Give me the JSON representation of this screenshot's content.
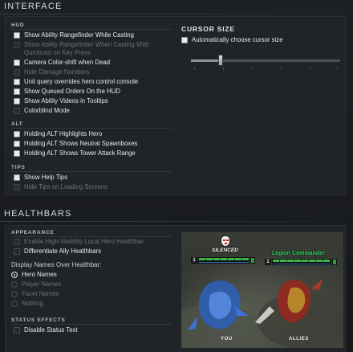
{
  "interface": {
    "title": "INTERFACE",
    "hud": {
      "label": "HUD",
      "options": [
        {
          "label": "Show Ability Rangefinder While Casting",
          "checked": true,
          "disabled": false
        },
        {
          "label": "Show Ability Rangefinder When Casting With",
          "label2": "Quickcast on Key Press",
          "checked": false,
          "disabled": true
        },
        {
          "label": "Camera Color-shift when Dead",
          "checked": true,
          "disabled": false
        },
        {
          "label": "Hide Damage Numbers",
          "checked": false,
          "disabled": true
        },
        {
          "label": "Unit query overrides hero control console",
          "checked": true,
          "disabled": false
        },
        {
          "label": "Show Queued Orders On the HUD",
          "checked": true,
          "disabled": false
        },
        {
          "label": "Show Ability Videos in Tooltips",
          "checked": true,
          "disabled": false
        },
        {
          "label": "Colorblind Mode",
          "checked": false,
          "disabled": false
        }
      ]
    },
    "alt": {
      "label": "ALT",
      "options": [
        {
          "label": "Holding ALT Highlights Hero",
          "checked": true,
          "disabled": false
        },
        {
          "label": "Holding ALT Shows Neutral Spawnboxes",
          "checked": true,
          "disabled": false
        },
        {
          "label": "Holding ALT Shows Tower Attack Range",
          "checked": true,
          "disabled": false
        }
      ]
    },
    "tips": {
      "label": "TIPS",
      "options": [
        {
          "label": "Show Help Tips",
          "checked": true,
          "disabled": false
        },
        {
          "label": "Hide Tips on Loading Screens",
          "checked": false,
          "disabled": true
        }
      ]
    },
    "cursor": {
      "label": "CURSOR SIZE",
      "auto_label": "Automatically choose cursor size",
      "auto_checked": true,
      "slider_value_fraction": 0.2
    }
  },
  "healthbars": {
    "title": "HEALTHBARS",
    "appearance": {
      "label": "APPEARANCE",
      "options": [
        {
          "label": "Enable High-Visibility Local Hero Healthbar",
          "checked": false,
          "disabled": true
        },
        {
          "label": "Differentiate Ally Healthbars",
          "checked": false,
          "disabled": false
        }
      ]
    },
    "display_names": {
      "label": "Display Names Over Healthbar:",
      "options": [
        {
          "label": "Hero Names",
          "selected": true
        },
        {
          "label": "Player Names",
          "selected": false
        },
        {
          "label": "Facet Names",
          "selected": false
        },
        {
          "label": "Nothing",
          "selected": false
        }
      ]
    },
    "status_effects": {
      "label": "STATUS EFFECTS",
      "options": [
        {
          "label": "Disable Status Text",
          "checked": false,
          "disabled": false
        }
      ]
    },
    "preview": {
      "you_label": "YOU",
      "allies_label": "ALLIES",
      "status_text": "SILENCED",
      "ally_name": "Legion Commander",
      "you_level": "1",
      "ally_level": "1"
    }
  }
}
